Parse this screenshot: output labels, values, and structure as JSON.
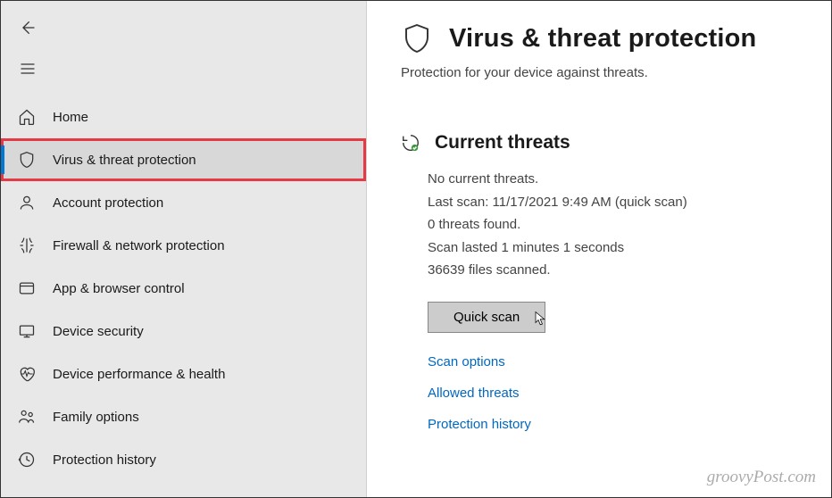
{
  "sidebar": {
    "items": [
      {
        "label": "Home"
      },
      {
        "label": "Virus & threat protection"
      },
      {
        "label": "Account protection"
      },
      {
        "label": "Firewall & network protection"
      },
      {
        "label": "App & browser control"
      },
      {
        "label": "Device security"
      },
      {
        "label": "Device performance & health"
      },
      {
        "label": "Family options"
      },
      {
        "label": "Protection history"
      }
    ]
  },
  "page": {
    "title": "Virus & threat protection",
    "subtitle": "Protection for your device against threats."
  },
  "threats": {
    "section_title": "Current threats",
    "status": "No current threats.",
    "last_scan": "Last scan: 11/17/2021 9:49 AM (quick scan)",
    "found": "0 threats found.",
    "duration": "Scan lasted 1 minutes 1 seconds",
    "files": "36639 files scanned.",
    "quick_scan_label": "Quick scan"
  },
  "links": {
    "scan_options": "Scan options",
    "allowed_threats": "Allowed threats",
    "protection_history": "Protection history"
  },
  "watermark": "groovyPost.com"
}
